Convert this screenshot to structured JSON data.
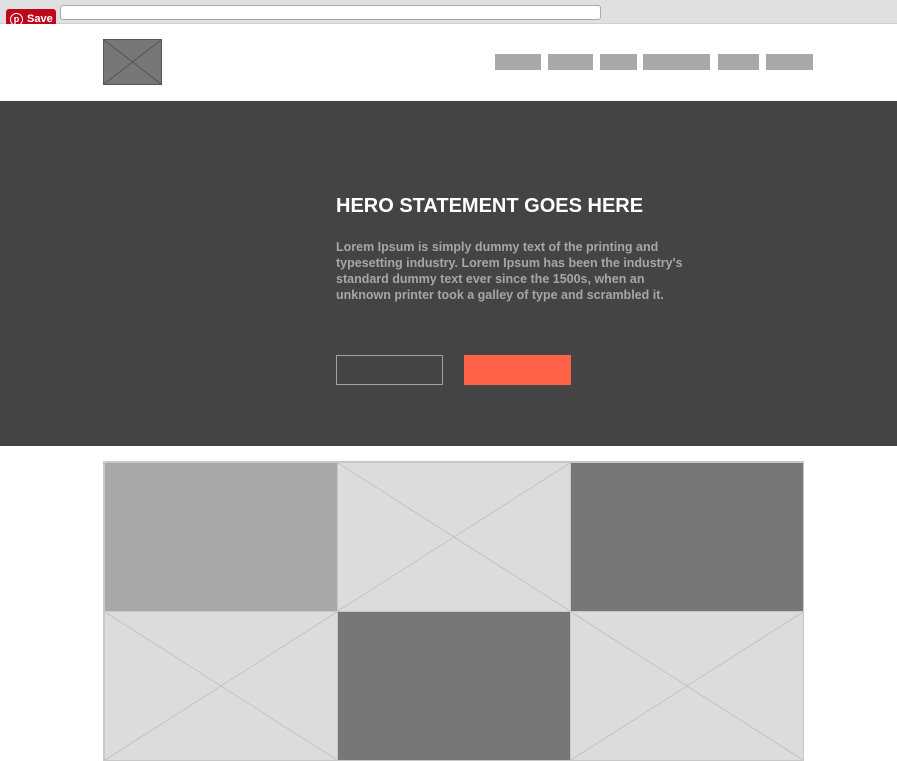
{
  "pinterest": {
    "save_label": "Save",
    "icon": "pinterest-icon"
  },
  "header": {
    "logo_icon": "image-placeholder-icon",
    "nav_count": 6
  },
  "hero": {
    "title": "HERO STATEMENT GOES HERE",
    "body": "Lorem Ipsum is simply dummy text of the printing and typesetting industry. Lorem Ipsum has been the industry's standard dummy text ever since the 1500s, when an unknown printer took a galley of type and scrambled it."
  },
  "grid": {
    "cells": [
      {
        "name": "grid-tile-1",
        "kind": "solid",
        "color": "#a8a8a8"
      },
      {
        "name": "grid-tile-2",
        "kind": "placeholder",
        "color": "#dcdcdc"
      },
      {
        "name": "grid-tile-3",
        "kind": "solid",
        "color": "#777777"
      },
      {
        "name": "grid-tile-4",
        "kind": "placeholder",
        "color": "#dcdcdc"
      },
      {
        "name": "grid-tile-5",
        "kind": "solid",
        "color": "#777777"
      },
      {
        "name": "grid-tile-6",
        "kind": "placeholder",
        "color": "#dcdcdc"
      }
    ]
  },
  "colors": {
    "hero_bg": "#444444",
    "accent": "#ff6347",
    "pin_red": "#bd081c"
  }
}
